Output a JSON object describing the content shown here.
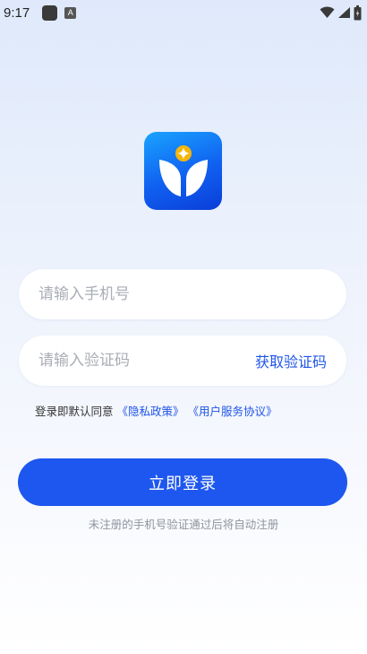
{
  "status_bar": {
    "time": "9:17",
    "icons": [
      "app-square-icon",
      "a-notification-icon",
      "wifi-icon",
      "cellular-signal-icon",
      "battery-icon"
    ]
  },
  "logo": {
    "name": "app-logo",
    "colors": {
      "bg_top": "#1aa3ff",
      "bg_bottom": "#0a3ed8",
      "star": "#f5b50a"
    }
  },
  "form": {
    "phone_placeholder": "请输入手机号",
    "phone_value": "",
    "code_placeholder": "请输入验证码",
    "code_value": "",
    "get_code_label": "获取验证码"
  },
  "agreement": {
    "prefix": "登录即默认同意",
    "privacy_link": "《隐私政策》",
    "service_link": "《用户服务协议》"
  },
  "login_button_label": "立即登录",
  "hint": "未注册的手机号验证通过后将自动注册",
  "colors": {
    "accent": "#1e57ef",
    "link": "#1f55e8",
    "placeholder": "#a9adb5",
    "hint": "#8f949c"
  }
}
